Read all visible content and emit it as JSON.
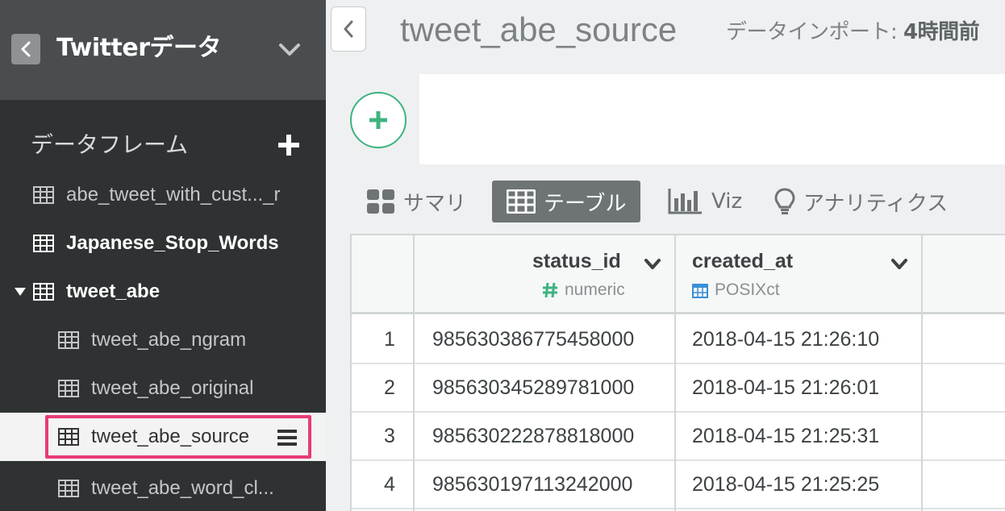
{
  "sidebar": {
    "project_title": "Twitterデータ",
    "section_label": "データフレーム",
    "items": [
      {
        "label": "abe_tweet_with_cust..._r"
      },
      {
        "label": "Japanese_Stop_Words"
      },
      {
        "label": "tweet_abe"
      },
      {
        "label": "tweet_abe_ngram"
      },
      {
        "label": "tweet_abe_original"
      },
      {
        "label": "tweet_abe_source"
      },
      {
        "label": "tweet_abe_word_cl..."
      }
    ]
  },
  "header": {
    "title": "tweet_abe_source",
    "import_prefix": "データインポート: ",
    "import_time": "4時間前"
  },
  "tabs": [
    {
      "label": "サマリ",
      "icon": "grid-icon"
    },
    {
      "label": "テーブル",
      "icon": "table-icon"
    },
    {
      "label": "Viz",
      "icon": "bar-chart-icon"
    },
    {
      "label": "アナリティクス",
      "icon": "lightbulb-icon"
    }
  ],
  "table": {
    "columns": [
      {
        "name": "status_id",
        "type": "numeric",
        "type_icon": "hash-icon"
      },
      {
        "name": "created_at",
        "type": "POSIXct",
        "type_icon": "calendar-icon"
      }
    ],
    "rows": [
      {
        "index": "1",
        "status_id": "985630386775458000",
        "created_at": "2018-04-15 21:26:10"
      },
      {
        "index": "2",
        "status_id": "985630345289781000",
        "created_at": "2018-04-15 21:26:01"
      },
      {
        "index": "3",
        "status_id": "985630222878818000",
        "created_at": "2018-04-15 21:25:31"
      },
      {
        "index": "4",
        "status_id": "985630197113242000",
        "created_at": "2018-04-15 21:25:25"
      }
    ]
  },
  "colors": {
    "accent_green": "#3fb37f",
    "highlight_pink": "#e83b78",
    "sidebar_bg": "#2f3233"
  }
}
